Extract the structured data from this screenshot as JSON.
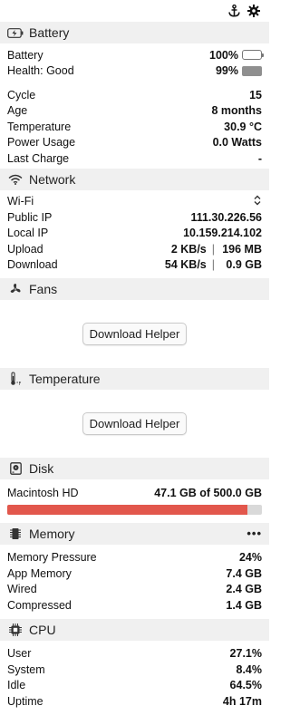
{
  "colors": {
    "battery_fill": "#4cd964",
    "health_fill": "#8e8e8e",
    "disk_fill": "#e2574c",
    "disk_track": "#d9d9d9"
  },
  "topbar": {
    "icons": [
      "anchor-icon",
      "gear-icon"
    ]
  },
  "battery": {
    "title": "Battery",
    "rows": [
      {
        "label": "Battery",
        "value": "100%"
      },
      {
        "label": "Health: Good",
        "value": "99%"
      }
    ],
    "level": 1.0,
    "health_level": 0.99,
    "details": [
      {
        "label": "Cycle",
        "value": "15"
      },
      {
        "label": "Age",
        "value": "8 months"
      },
      {
        "label": "Temperature",
        "value": "30.9 °C"
      },
      {
        "label": "Power Usage",
        "value": "0.0 Watts"
      },
      {
        "label": "Last Charge",
        "value": "-"
      }
    ]
  },
  "network": {
    "title": "Network",
    "interface": "Wi-Fi",
    "public_ip_label": "Public IP",
    "public_ip": "111.30.226.56",
    "local_ip_label": "Local IP",
    "local_ip": "10.159.214.102",
    "upload_label": "Upload",
    "upload_rate": "2 KB/s",
    "upload_total": "196 MB",
    "download_label": "Download",
    "download_rate": "54 KB/s",
    "download_total": "0.9 GB",
    "separator": "|"
  },
  "fans": {
    "title": "Fans",
    "button": "Download Helper"
  },
  "temperature": {
    "title": "Temperature",
    "button": "Download Helper"
  },
  "disk": {
    "title": "Disk",
    "name": "Macintosh HD",
    "usage": "47.1 GB of 500.0 GB",
    "used_fraction": 0.942
  },
  "memory": {
    "title": "Memory",
    "more": "•••",
    "rows": [
      {
        "label": "Memory Pressure",
        "value": "24%"
      },
      {
        "label": "App Memory",
        "value": "7.4 GB"
      },
      {
        "label": "Wired",
        "value": "2.4 GB"
      },
      {
        "label": "Compressed",
        "value": "1.4 GB"
      }
    ]
  },
  "cpu": {
    "title": "CPU",
    "rows": [
      {
        "label": "User",
        "value": "27.1%"
      },
      {
        "label": "System",
        "value": "8.4%"
      },
      {
        "label": "Idle",
        "value": "64.5%"
      },
      {
        "label": "Uptime",
        "value": "4h 17m"
      }
    ]
  }
}
